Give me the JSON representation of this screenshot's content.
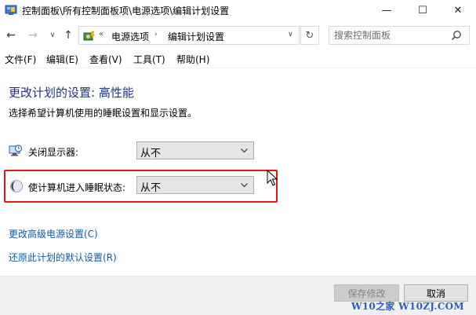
{
  "window": {
    "title": "控制面板\\所有控制面板项\\电源选项\\编辑计划设置",
    "minimize_glyph": "—",
    "maximize_glyph": "☐",
    "close_glyph": "✕"
  },
  "nav": {
    "back_glyph": "←",
    "forward_glyph": "→",
    "recent_glyph": "∨",
    "up_glyph": "↑",
    "refresh_glyph": "↻"
  },
  "address": {
    "overflow": "«",
    "segments": [
      "电源选项",
      "编辑计划设置"
    ],
    "separator": "›",
    "dropdown": "∨"
  },
  "search": {
    "placeholder": "搜索控制面板"
  },
  "menu": {
    "items": [
      "文件(F)",
      "编辑(E)",
      "查看(V)",
      "工具(T)",
      "帮助(H)"
    ]
  },
  "content": {
    "title": "更改计划的设置: 高性能",
    "subtitle": "选择希望计算机使用的睡眠设置和显示设置。",
    "display_off": {
      "label": "关闭显示器:",
      "value": "从不"
    },
    "sleep": {
      "label": "使计算机进入睡眠状态:",
      "value": "从不"
    },
    "links": {
      "advanced": "更改高级电源设置(C)",
      "restore": "还原此计划的默认设置(R)"
    }
  },
  "footer": {
    "save_label": "保存修改",
    "cancel_label": "取消",
    "watermark": "W10之家 W10ZJ.COM"
  },
  "colors": {
    "title_blue": "#1e3287",
    "link_blue": "#0a5ca8",
    "highlight_red": "#e2141c"
  }
}
